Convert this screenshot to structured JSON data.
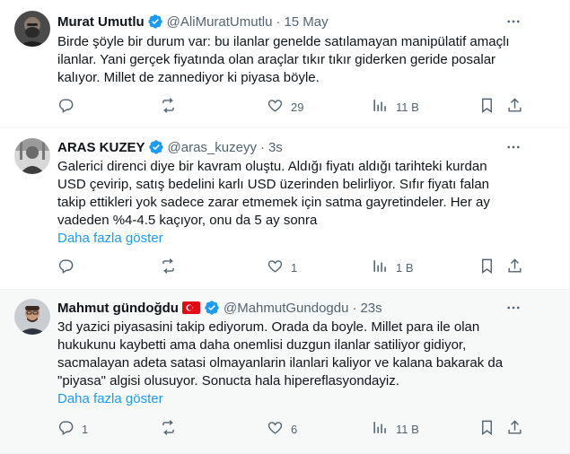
{
  "tweets": [
    {
      "name": "Murat Umutlu",
      "handle": "@AliMuratUmutlu",
      "time": "15 May",
      "text": [
        "Birde şöyle bir durum var: bu ilanlar genelde satılamayan manipülatif amaçlı",
        "ilanlar. Yani gerçek fiyatında olan araçlar tıkır tıkır giderken geride posalar",
        "kalıyor. Millet de zannediyor ki piyasa böyle."
      ],
      "show_more": "",
      "replies": "",
      "retweets": "",
      "likes": "29",
      "views": "11 B"
    },
    {
      "name": "ARAS KUZEY",
      "handle": "@aras_kuzeyy",
      "time": "3s",
      "text": [
        "Galerici direnci diye bir kavram oluştu. Aldığı fiyatı aldığı tarihteki kurdan",
        "USD çevirip, satış bedelini karlı USD üzerinden belirliyor. Sıfır fiyatı falan",
        "takip ettikleri yok sadece zarar etmemek için satma gayretindeler. Her ay",
        "vadeden %4-4.5 kaçıyor, onu da 5 ay sonra"
      ],
      "show_more": "Daha fazla göster",
      "replies": "",
      "retweets": "",
      "likes": "1",
      "views": "1 B"
    },
    {
      "name": "Mahmut gündoğdu",
      "handle": "@MahmutGundogdu",
      "time": "23s",
      "text": [
        "3d yazici piyasasini takip ediyorum. Orada da boyle. Millet para ile olan",
        "hukukunu kaybetti ama daha onemlisi duzgun ilanlar satiliyor gidiyor,",
        "sacmalayan adeta satasi olmayanlarin ilanlari kaliyor ve kalana bakarak da",
        "\"piyasa\" algisi olusuyor. Sonucta hala hipereflasyondayiz."
      ],
      "show_more": "Daha fazla göster",
      "replies": "1",
      "retweets": "",
      "likes": "6",
      "views": "11 B"
    }
  ],
  "colors": {
    "verified": "#1d9bf0",
    "link": "#1d9bf0",
    "secondary_text": "#536471",
    "highlight_bg": "#f7f9f9"
  },
  "icons": [
    "verified-badge-icon",
    "turkey-flag-icon",
    "more-icon",
    "reply-icon",
    "retweet-icon",
    "like-icon",
    "views-icon",
    "bookmark-icon",
    "share-icon"
  ]
}
